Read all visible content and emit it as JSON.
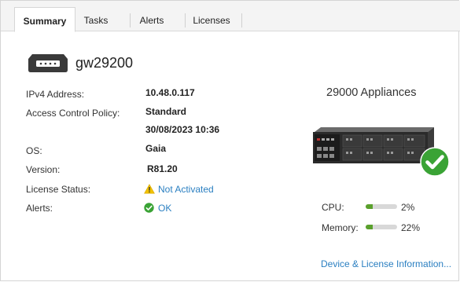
{
  "tabs": [
    {
      "label": "Summary",
      "active": true
    },
    {
      "label": "Tasks",
      "active": false
    },
    {
      "label": "Alerts",
      "active": false
    },
    {
      "label": "Licenses",
      "active": false
    }
  ],
  "gateway": {
    "name": "gw29200",
    "icon": "gateway-device-icon"
  },
  "details": {
    "ipv4_label": "IPv4 Address:",
    "ipv4_value": "10.48.0.117",
    "policy_label": "Access Control Policy:",
    "policy_value": "Standard",
    "policy_date": "30/08/2023 10:36",
    "os_label": "OS:",
    "os_value": "Gaia",
    "version_label": "Version:",
    "version_value": "R81.20",
    "license_label": "License Status:",
    "license_value": "Not Activated",
    "license_icon": "warning-icon",
    "alerts_label": "Alerts:",
    "alerts_value": "OK",
    "alerts_icon": "ok-check-icon"
  },
  "appliance": {
    "title": "29000 Appliances",
    "status_icon": "green-check-icon"
  },
  "resources": {
    "cpu_label": "CPU:",
    "cpu_value": "2%",
    "cpu_fraction": 0.02,
    "memory_label": "Memory:",
    "memory_value": "22%",
    "memory_fraction": 0.22
  },
  "footer": {
    "device_link": "Device & License Information..."
  },
  "colors": {
    "link": "#2a7fc1",
    "ok_green": "#3aa335",
    "warning_yellow": "#f2c200",
    "bar_green": "#5aa02c"
  }
}
